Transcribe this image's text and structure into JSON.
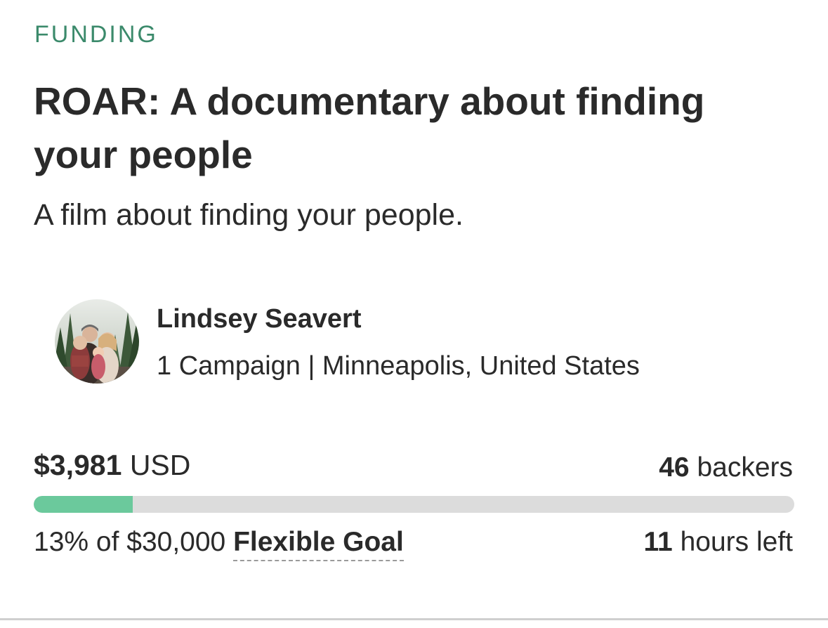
{
  "campaign": {
    "status_label": "FUNDING",
    "title": "ROAR: A documentary about finding your people",
    "tagline": "A film about finding your people."
  },
  "owner": {
    "name": "Lindsey Seavert",
    "meta": "1 Campaign | Minneapolis, United States",
    "avatar_icon": "campaigner-avatar-photo"
  },
  "funding": {
    "raised_amount": "$3,981",
    "currency": "USD",
    "backers_count": "46",
    "backers_label": "backers",
    "percent_text": "13% of $30,000",
    "goal_type": "Flexible Goal",
    "progress_percent": 13,
    "time_left_value": "11",
    "time_left_label": "hours left"
  },
  "colors": {
    "status_label": "#3b8a6b",
    "progress_fill": "#6bc99c",
    "progress_track": "#dcdcdc",
    "text": "#2a2a2a"
  }
}
